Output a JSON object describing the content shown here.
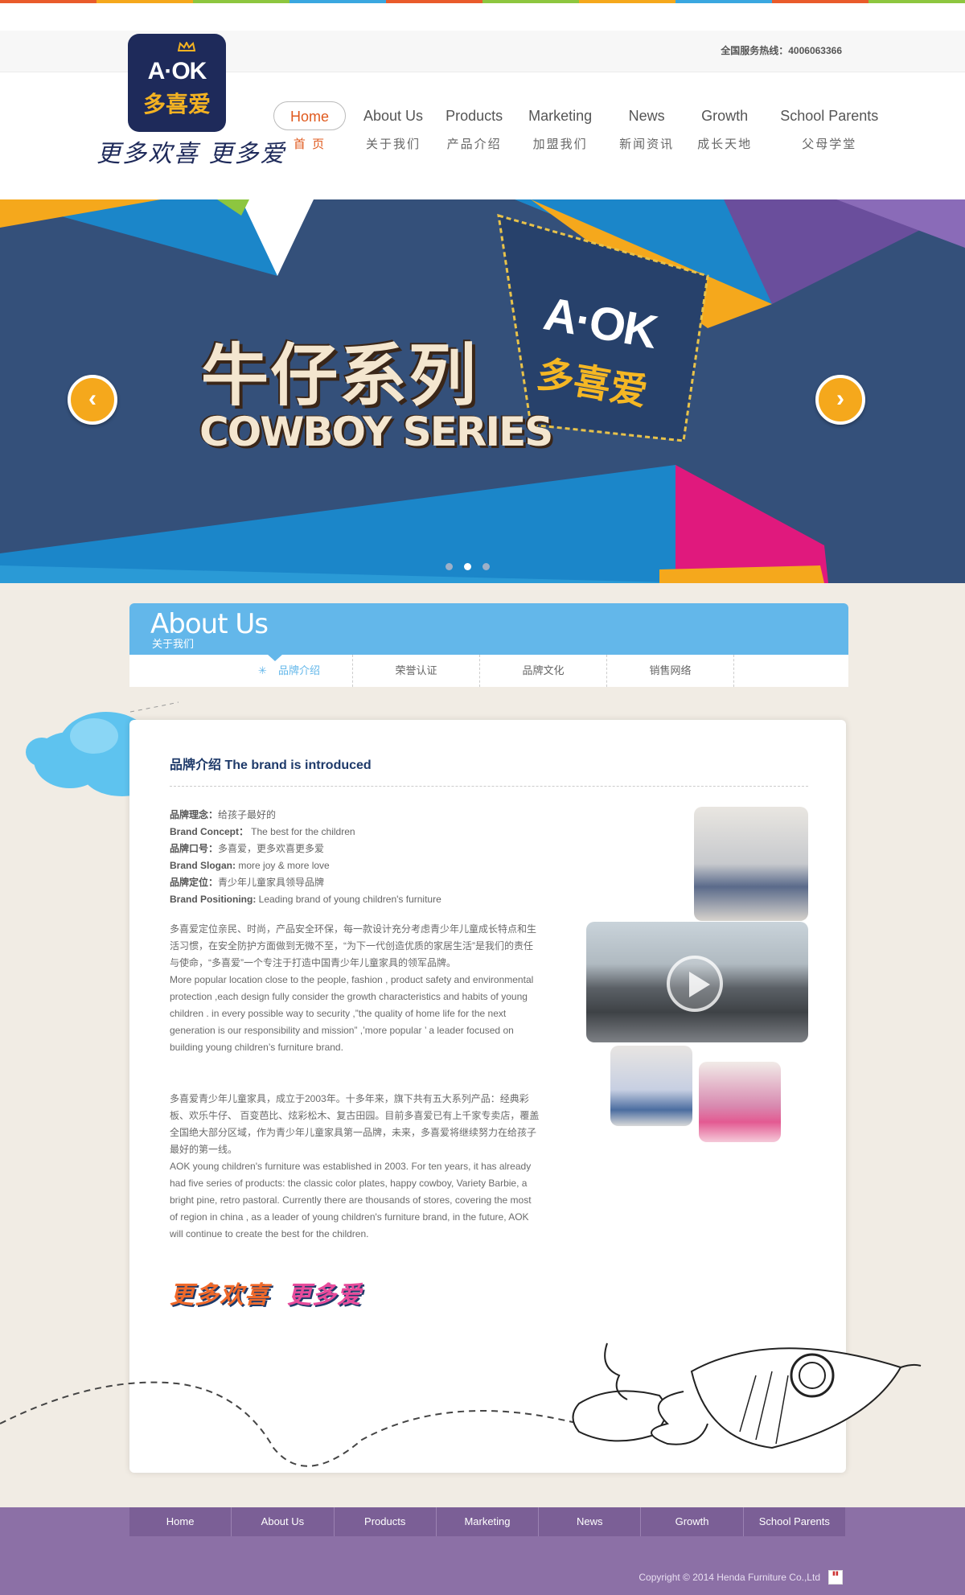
{
  "stripe_colors": [
    "#e95b2b",
    "#f5a81c",
    "#8dc63f",
    "#3aa7e0",
    "#e95b2b",
    "#8dc63f",
    "#f5a81c",
    "#3aa7e0",
    "#e95b2b",
    "#8dc63f"
  ],
  "header": {
    "hotline": "全国服务热线：4006063366",
    "logo": {
      "en": "A·OK",
      "cn": "多喜爱"
    },
    "slogan": "更多欢喜 更多爱"
  },
  "nav": [
    {
      "en": "Home",
      "cn": "首 页",
      "active": true
    },
    {
      "en": "About Us",
      "cn": "关于我们"
    },
    {
      "en": "Products",
      "cn": "产品介绍"
    },
    {
      "en": "Marketing",
      "cn": "加盟我们"
    },
    {
      "en": "News",
      "cn": "新闻资讯"
    },
    {
      "en": "Growth",
      "cn": "成长天地"
    },
    {
      "en": "School Parents",
      "cn": "父母学堂"
    }
  ],
  "banner": {
    "title_cn": "牛仔系列",
    "title_en": "COWBOY SERIES",
    "pocket_en": "A·OK",
    "pocket_cn": "多喜爱",
    "prev": "‹",
    "next": "›",
    "slide_count": 3,
    "active_slide": 2
  },
  "about": {
    "title_en": "About Us",
    "title_cn": "关于我们",
    "tabs": [
      "品牌介绍",
      "荣誉认证",
      "品牌文化",
      "销售网络"
    ],
    "active_tab": 0,
    "tab_star": "✳"
  },
  "card": {
    "title": "品牌介绍 The brand is introduced",
    "facts": [
      {
        "k": "品牌理念：",
        "v": "给孩子最好的"
      },
      {
        "k": "Brand Concept：",
        "v": " The best for the children"
      },
      {
        "k": "品牌口号：",
        "v": "多喜爱，更多欢喜更多爱"
      },
      {
        "k": "Brand Slogan:",
        "v": " more joy & more love"
      },
      {
        "k": "品牌定位：",
        "v": "青少年儿童家具领导品牌"
      },
      {
        "k": "Brand Positioning:",
        "v": " Leading brand of young children's furniture"
      }
    ],
    "para1": [
      "多喜爱定位亲民、时尚，产品安全环保，每一款设计充分考虑青少年儿童成长特点和生活习惯，在安全防护方面做到无微不至，“为下一代创造优质的家居生活”是我们的责任与使命，“多喜爱”一个专注于打造中国青少年儿童家具的领军品牌。",
      "More popular location close to the people, fashion , product safety and environmental  protection  ,each design fully consider the growth characteristics and habits of young children . in every possible way to security ,”the quality of home life for the next generation is our responsibility and mission” ,’more popular ’ a leader focused on building young children’s furniture brand."
    ],
    "para2": [
      "多喜爱青少年儿童家具，成立于2003年。十多年来，旗下共有五大系列产品：经典彩板、欢乐牛仔、 百变芭比、炫彩松木、复古田园。目前多喜爱已有上千家专卖店，覆盖全国绝大部分区域，作为青少年儿童家具第一品牌，未来，多喜爱将继续努力在给孩子最好的第一线。",
      "AOK young children's furniture was established in 2003. For ten years, it has already had five series of products: the classic color plates, happy cowboy, Variety Barbie, a bright pine, retro pastoral. Currently there are thousands of stores, covering the most of region in china , as a leader of young children's furniture brand, in the future, AOK will continue to create the best for the children."
    ],
    "slogan_badge": [
      "更多欢喜",
      "更多爱"
    ],
    "slogan_badge_colors": [
      "#f0692a",
      "#f5b724",
      "#69bd45",
      "#e84b9b",
      "#f5b724",
      "#3aa7e0",
      "#e84b9b"
    ]
  },
  "footer": {
    "nav": [
      "Home",
      "About Us",
      "Products",
      "Marketing",
      "News",
      "Growth",
      "School Parents"
    ],
    "copyright": "Copyright © 2014 Henda Furniture Co.,Ltd"
  }
}
